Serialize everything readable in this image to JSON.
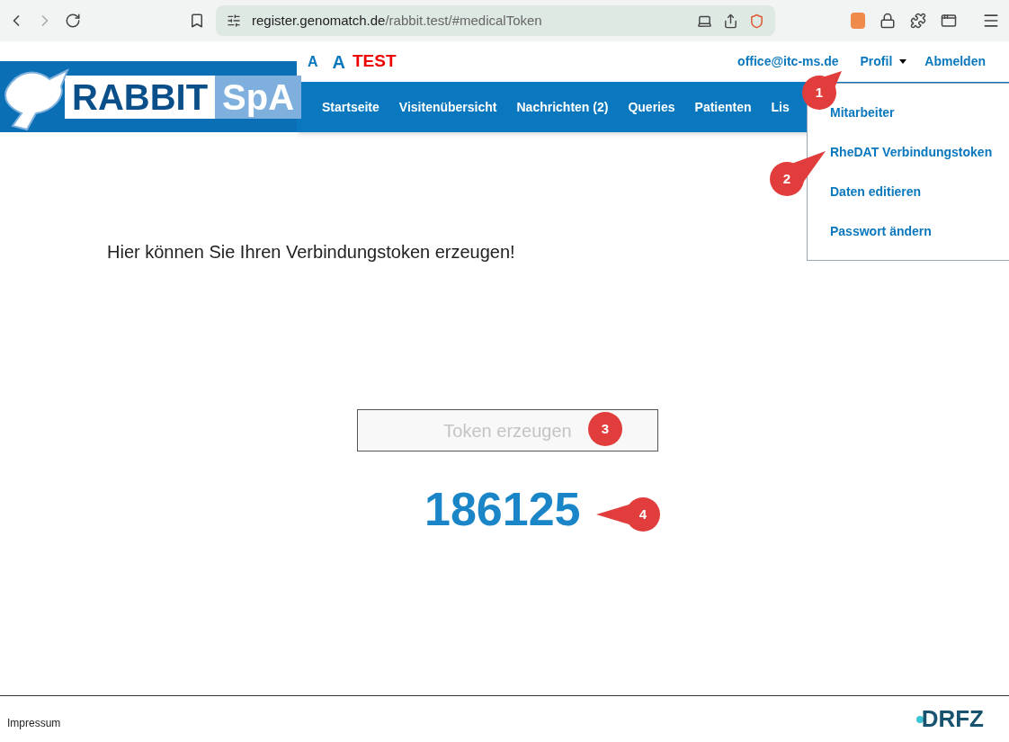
{
  "browser": {
    "url_host": "register.genomatch.de",
    "url_path": "/rabbit.test/#medicalToken"
  },
  "header": {
    "logo_text": [
      "RABBIT",
      "SpA"
    ],
    "font_size_links": [
      "A",
      "A"
    ],
    "environment_label": "TEST",
    "user_email": "office@itc-ms.de",
    "profile_menu": {
      "label": "Profil",
      "expanded": true
    },
    "logout": "Abmelden"
  },
  "nav": [
    "Startseite",
    "Visitenübersicht",
    "Nachrichten (2)",
    "Queries",
    "Patienten",
    "Lis"
  ],
  "profile_dropdown": [
    "Mitarbeiter",
    "RheDAT Verbindungstoken",
    "Daten editieren",
    "Passwort ändern"
  ],
  "main": {
    "heading": "Hier können Sie Ihren Verbindungstoken erzeugen!",
    "button": "Token erzeugen",
    "token": "186125"
  },
  "footer": {
    "link": "Impressum",
    "logo_text": "DRFZ"
  },
  "callouts": [
    "1",
    "2",
    "3",
    "4"
  ]
}
